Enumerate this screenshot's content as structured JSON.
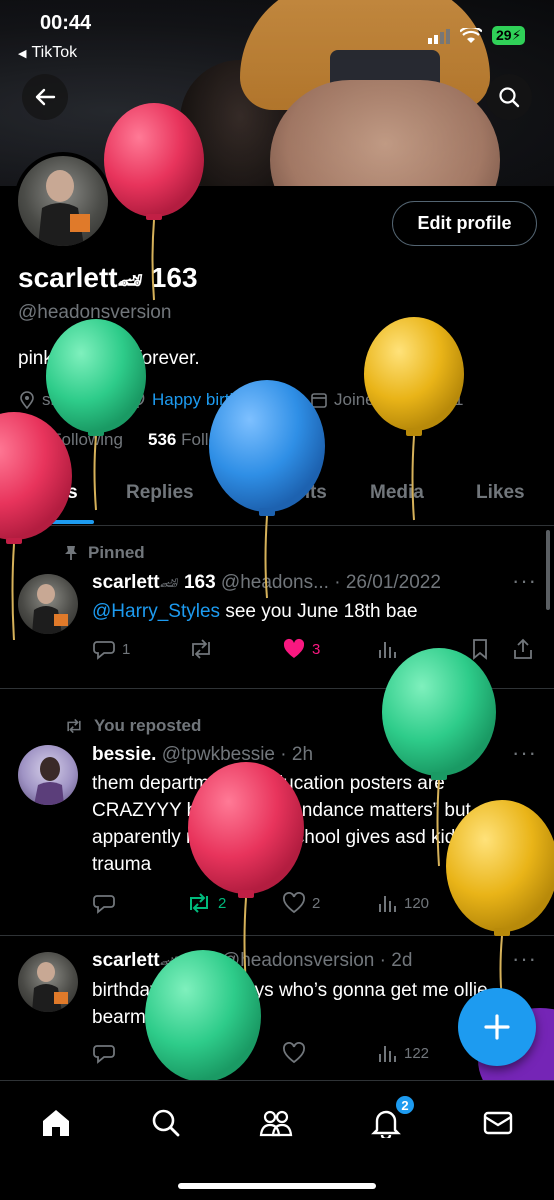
{
  "status_bar": {
    "time": "00:44",
    "back_app": "TikTok",
    "battery": "29"
  },
  "header": {
    "edit_profile_label": "Edit profile"
  },
  "profile": {
    "display_name": "scarlett",
    "display_name_suffix": "163",
    "handle": "@headonsversion",
    "bio": "pink and blue forever.",
    "pronouns": "she/her",
    "birthday": "Happy birthday!",
    "joined": "Joined May 2021",
    "following_count": "477",
    "following_label": "Following",
    "followers_count": "536",
    "followers_label": "Followers"
  },
  "tabs": [
    {
      "label": "Posts"
    },
    {
      "label": "Replies"
    },
    {
      "label": "Highlights"
    },
    {
      "label": "Media"
    },
    {
      "label": "Likes"
    }
  ],
  "posts": [
    {
      "context": "Pinned",
      "name": "scarlett",
      "name_suffix": "163",
      "handle": "@headons...",
      "time": "26/01/2022",
      "mention": "@Harry_Styles",
      "text": " see you June 18th bae",
      "replies": "1",
      "reposts": "",
      "likes": "3",
      "views": ""
    },
    {
      "context": "You reposted",
      "name": "bessie.",
      "handle": "@tpwkbessie",
      "time": "2h",
      "text": "them department of education posters are CRAZYYY because “attendance matters” but apparently not the fact school gives asd kids trauma",
      "replies": "",
      "reposts": "2",
      "likes": "2",
      "views": "120"
    },
    {
      "name": "scarlett",
      "name_suffix": "163",
      "handle": "@headonsversion",
      "time": "2d",
      "text": "birthday in three days who’s gonna get me ollie bearman",
      "replies": "",
      "reposts": "",
      "likes": "",
      "views": "122"
    }
  ],
  "notifications_badge": "2",
  "colors": {
    "accent": "#1d9bf0",
    "like": "#f91880",
    "repost": "#00ba7c",
    "balloon_pink": "#e8345c",
    "balloon_green": "#2ecc8a",
    "balloon_blue": "#2f8fe6",
    "balloon_yellow": "#e9b418"
  }
}
